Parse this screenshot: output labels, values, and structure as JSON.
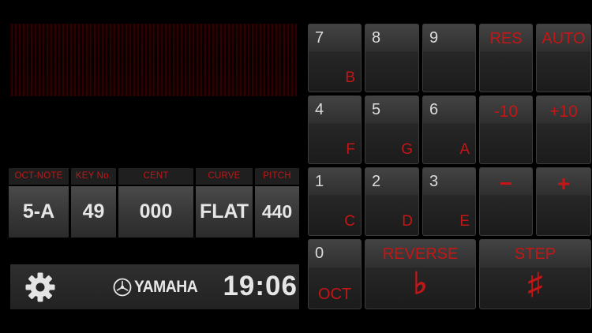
{
  "readout": {
    "headers": {
      "oct_note": "OCT-NOTE",
      "key_no": "KEY No.",
      "cent": "CENT",
      "curve": "CURVE",
      "pitch": "PITCH"
    },
    "values": {
      "oct_note": "5-A",
      "key_no": "49",
      "cent": "000",
      "curve": "FLAT",
      "pitch": "440"
    }
  },
  "status": {
    "brand": "YAMAHA",
    "clock": "19:06"
  },
  "keypad": {
    "k7": {
      "num": "7",
      "note": "B"
    },
    "k8": {
      "num": "8"
    },
    "k9": {
      "num": "9"
    },
    "res": "RES",
    "auto": "AUTO",
    "k4": {
      "num": "4",
      "note": "F"
    },
    "k5": {
      "num": "5",
      "note": "G"
    },
    "k6": {
      "num": "6",
      "note": "A"
    },
    "minus10": "-10",
    "plus10": "+10",
    "k1": {
      "num": "1",
      "note": "C"
    },
    "k2": {
      "num": "2",
      "note": "D"
    },
    "k3": {
      "num": "3",
      "note": "E"
    },
    "minus": "−",
    "plus": "+",
    "k0": {
      "num": "0",
      "label": "OCT"
    },
    "reverse": {
      "label": "REVERSE",
      "symbol": "♭"
    },
    "step": {
      "label": "STEP",
      "symbol": "♯"
    }
  },
  "colors": {
    "accent_red": "#c41616",
    "text_light": "#e6e6e6",
    "panel_dark": "#1f1f1f"
  },
  "icons": {
    "settings": "gear-icon",
    "brand": "tuning-fork-emblem-icon"
  }
}
